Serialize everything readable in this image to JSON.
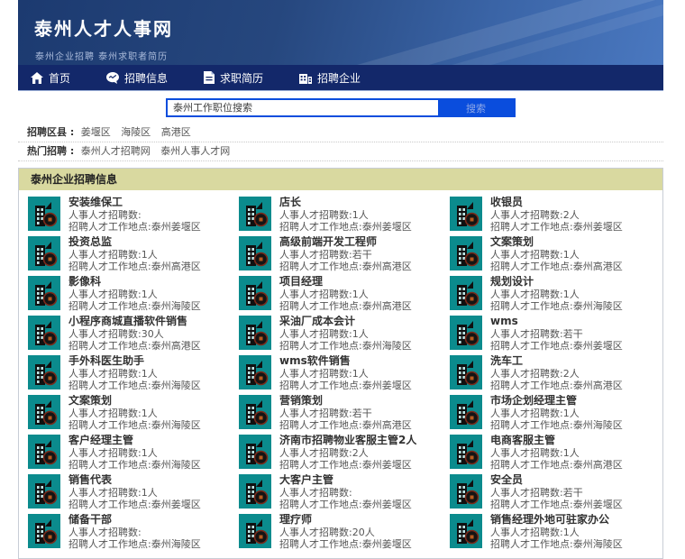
{
  "header": {
    "title": "泰州人才人事网",
    "subtitle": "泰州企业招聘 泰州求职者简历"
  },
  "nav": {
    "items": [
      {
        "label": "首页",
        "icon": "home-icon"
      },
      {
        "label": "招聘信息",
        "icon": "chat-icon"
      },
      {
        "label": "求职简历",
        "icon": "resume-icon"
      },
      {
        "label": "招聘企业",
        "icon": "company-icon"
      }
    ]
  },
  "search": {
    "placeholder": "泰州工作职位搜索",
    "button_label": "搜索"
  },
  "filters": {
    "region_label": "招聘区县 :",
    "regions": [
      "姜堰区",
      "海陵区",
      "高港区"
    ],
    "hot_label": "热门招聘 :",
    "hot_links": [
      "泰州人才招聘网",
      "泰州人事人才网"
    ]
  },
  "panel": {
    "title": "泰州企业招聘信息"
  },
  "jobs": [
    {
      "title": "安装维保工",
      "count": "人事人才招聘数:",
      "location": "招聘人才工作地点:泰州姜堰区"
    },
    {
      "title": "店长",
      "count": "人事人才招聘数:1人",
      "location": "招聘人才工作地点:泰州姜堰区"
    },
    {
      "title": "收银员",
      "count": "人事人才招聘数:2人",
      "location": "招聘人才工作地点:泰州姜堰区"
    },
    {
      "title": "投资总监",
      "count": "人事人才招聘数:1人",
      "location": "招聘人才工作地点:泰州高港区"
    },
    {
      "title": "高级前端开发工程师",
      "count": "人事人才招聘数:若干",
      "location": "招聘人才工作地点:泰州高港区"
    },
    {
      "title": "文案策划",
      "count": "人事人才招聘数:1人",
      "location": "招聘人才工作地点:泰州高港区"
    },
    {
      "title": "影像科",
      "count": "人事人才招聘数:1人",
      "location": "招聘人才工作地点:泰州海陵区"
    },
    {
      "title": "项目经理",
      "count": "人事人才招聘数:1人",
      "location": "招聘人才工作地点:泰州高港区"
    },
    {
      "title": "规划设计",
      "count": "人事人才招聘数:1人",
      "location": "招聘人才工作地点:泰州海陵区"
    },
    {
      "title": "小程序商城直播软件销售",
      "count": "人事人才招聘数:30人",
      "location": "招聘人才工作地点:泰州高港区"
    },
    {
      "title": "采油厂成本会计",
      "count": "人事人才招聘数:1人",
      "location": "招聘人才工作地点:泰州海陵区"
    },
    {
      "title": "wms",
      "count": "人事人才招聘数:若干",
      "location": "招聘人才工作地点:泰州姜堰区"
    },
    {
      "title": "手外科医生助手",
      "count": "人事人才招聘数:1人",
      "location": "招聘人才工作地点:泰州海陵区"
    },
    {
      "title": "wms软件销售",
      "count": "人事人才招聘数:1人",
      "location": "招聘人才工作地点:泰州姜堰区"
    },
    {
      "title": "洗车工",
      "count": "人事人才招聘数:2人",
      "location": "招聘人才工作地点:泰州高港区"
    },
    {
      "title": "文案策划",
      "count": "人事人才招聘数:1人",
      "location": "招聘人才工作地点:泰州海陵区"
    },
    {
      "title": "营销策划",
      "count": "人事人才招聘数:若干",
      "location": "招聘人才工作地点:泰州高港区"
    },
    {
      "title": "市场企划经理主管",
      "count": "人事人才招聘数:1人",
      "location": "招聘人才工作地点:泰州海陵区"
    },
    {
      "title": "客户经理主管",
      "count": "人事人才招聘数:1人",
      "location": "招聘人才工作地点:泰州海陵区"
    },
    {
      "title": "济南市招聘物业客服主管2人",
      "count": "人事人才招聘数:2人",
      "location": "招聘人才工作地点:泰州姜堰区"
    },
    {
      "title": "电商客服主管",
      "count": "人事人才招聘数:1人",
      "location": "招聘人才工作地点:泰州高港区"
    },
    {
      "title": "销售代表",
      "count": "人事人才招聘数:1人",
      "location": "招聘人才工作地点:泰州姜堰区"
    },
    {
      "title": "大客户主管",
      "count": "人事人才招聘数:",
      "location": "招聘人才工作地点:泰州姜堰区"
    },
    {
      "title": "安全员",
      "count": "人事人才招聘数:若干",
      "location": "招聘人才工作地点:泰州姜堰区"
    },
    {
      "title": "储备干部",
      "count": "人事人才招聘数:",
      "location": "招聘人才工作地点:泰州海陵区"
    },
    {
      "title": "理疗师",
      "count": "人事人才招聘数:20人",
      "location": "招聘人才工作地点:泰州姜堰区"
    },
    {
      "title": "销售经理外地可驻家办公",
      "count": "人事人才招聘数:1人",
      "location": "招聘人才工作地点:泰州海陵区"
    }
  ],
  "colors": {
    "accent_blue": "#0a4ddd",
    "nav_navy": "#13286a",
    "header_blue": "#2c5293",
    "panel_header_bg": "#d9d9a0",
    "icon_teal": "#0b8b8d",
    "icon_badge_red": "#7a2a1a"
  }
}
